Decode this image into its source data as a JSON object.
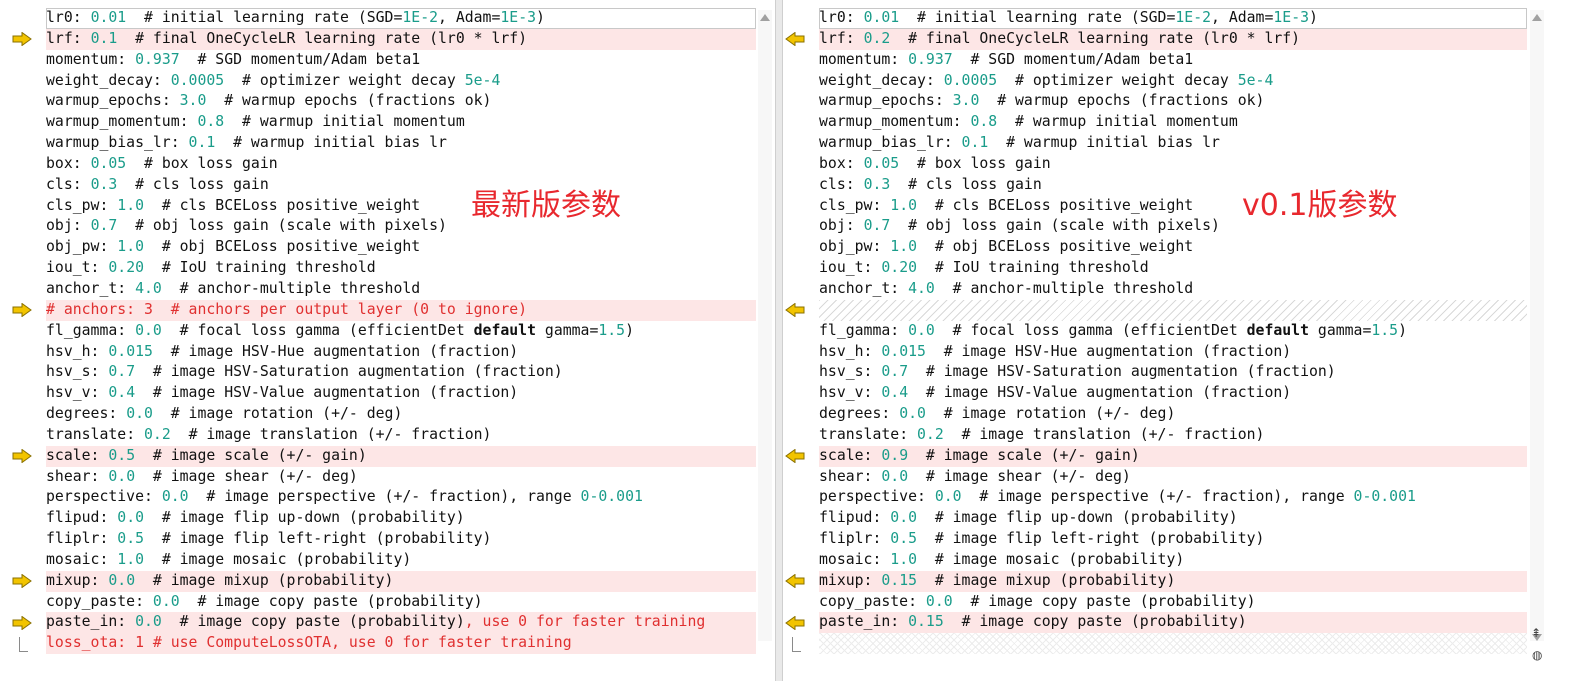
{
  "overlay_labels": {
    "left": "最新版参数",
    "right": "v0.1版参数"
  },
  "left_lines": [
    {
      "key": "lr0",
      "val": "0.01",
      "mid": "  # initial learning rate (SGD=",
      "n1": "1E-2",
      "mid2": ", Adam=",
      "n2": "1E-3",
      "tail": ")"
    },
    {
      "key": "lrf",
      "val": "0.1",
      "mid": "  # final OneCycleLR learning rate (lr0 * lrf)"
    },
    {
      "key": "momentum",
      "val": "0.937",
      "mid": "  # SGD momentum/Adam beta1"
    },
    {
      "key": "weight_decay",
      "val": "0.0005",
      "mid": "  # optimizer weight decay ",
      "n1": "5e-4"
    },
    {
      "key": "warmup_epochs",
      "val": "3.0",
      "mid": "  # warmup epochs (fractions ok)"
    },
    {
      "key": "warmup_momentum",
      "val": "0.8",
      "mid": "  # warmup initial momentum"
    },
    {
      "key": "warmup_bias_lr",
      "val": "0.1",
      "mid": "  # warmup initial bias lr"
    },
    {
      "key": "box",
      "val": "0.05",
      "mid": "  # box loss gain"
    },
    {
      "key": "cls",
      "val": "0.3",
      "mid": "  # cls loss gain"
    },
    {
      "key": "cls_pw",
      "val": "1.0",
      "mid": "  # cls BCELoss positive_weight"
    },
    {
      "key": "obj",
      "val": "0.7",
      "mid": "  # obj loss gain (scale with pixels)"
    },
    {
      "key": "obj_pw",
      "val": "1.0",
      "mid": "  # obj BCELoss positive_weight"
    },
    {
      "key": "iou_t",
      "val": "0.20",
      "mid": "  # IoU training threshold"
    },
    {
      "key": "anchor_t",
      "val": "4.0",
      "mid": "  # anchor-multiple threshold"
    },
    {
      "text": "# anchors: 3  # anchors per output layer (0 to ignore)"
    },
    {
      "key": "fl_gamma",
      "val": "0.0",
      "mid": "  # focal loss gamma (efficientDet ",
      "bold": "default",
      "mid2": " gamma=",
      "n2": "1.5",
      "tail": ")"
    },
    {
      "key": "hsv_h",
      "val": "0.015",
      "mid": "  # image HSV-Hue augmentation (fraction)"
    },
    {
      "key": "hsv_s",
      "val": "0.7",
      "mid": "  # image HSV-Saturation augmentation (fraction)"
    },
    {
      "key": "hsv_v",
      "val": "0.4",
      "mid": "  # image HSV-Value augmentation (fraction)"
    },
    {
      "key": "degrees",
      "val": "0.0",
      "mid": "  # image rotation (+/- deg)"
    },
    {
      "key": "translate",
      "val": "0.2",
      "mid": "  # image translation (+/- fraction)"
    },
    {
      "key": "scale",
      "val": "0.5",
      "mid": "  # image scale (+/- gain)"
    },
    {
      "key": "shear",
      "val": "0.0",
      "mid": "  # image shear (+/- deg)"
    },
    {
      "key": "perspective",
      "val": "0.0",
      "mid": "  # image perspective (+/- fraction), range ",
      "n1": "0-0.001"
    },
    {
      "key": "flipud",
      "val": "0.0",
      "mid": "  # image flip up-down (probability)"
    },
    {
      "key": "fliplr",
      "val": "0.5",
      "mid": "  # image flip left-right (probability)"
    },
    {
      "key": "mosaic",
      "val": "1.0",
      "mid": "  # image mosaic (probability)"
    },
    {
      "key": "mixup",
      "val": "0.0",
      "mid": "  # image mixup (probability)"
    },
    {
      "key": "copy_paste",
      "val": "0.0",
      "mid": "  # image copy paste (probability)"
    },
    {
      "key": "paste_in",
      "val": "0.0",
      "mid": "  # image copy paste (probability)",
      "redtail": ", use 0 for faster training"
    },
    {
      "text": "loss_ota: 1 # use ComputeLossOTA, use 0 for faster training"
    }
  ],
  "right_lines": [
    {
      "key": "lr0",
      "val": "0.01",
      "mid": "  # initial learning rate (SGD=",
      "n1": "1E-2",
      "mid2": ", Adam=",
      "n2": "1E-3",
      "tail": ")"
    },
    {
      "key": "lrf",
      "val": "0.2",
      "mid": "  # final OneCycleLR learning rate (lr0 * lrf)"
    },
    {
      "key": "momentum",
      "val": "0.937",
      "mid": "  # SGD momentum/Adam beta1"
    },
    {
      "key": "weight_decay",
      "val": "0.0005",
      "mid": "  # optimizer weight decay ",
      "n1": "5e-4"
    },
    {
      "key": "warmup_epochs",
      "val": "3.0",
      "mid": "  # warmup epochs (fractions ok)"
    },
    {
      "key": "warmup_momentum",
      "val": "0.8",
      "mid": "  # warmup initial momentum"
    },
    {
      "key": "warmup_bias_lr",
      "val": "0.1",
      "mid": "  # warmup initial bias lr"
    },
    {
      "key": "box",
      "val": "0.05",
      "mid": "  # box loss gain"
    },
    {
      "key": "cls",
      "val": "0.3",
      "mid": "  # cls loss gain"
    },
    {
      "key": "cls_pw",
      "val": "1.0",
      "mid": "  # cls BCELoss positive_weight"
    },
    {
      "key": "obj",
      "val": "0.7",
      "mid": "  # obj loss gain (scale with pixels)"
    },
    {
      "key": "obj_pw",
      "val": "1.0",
      "mid": "  # obj BCELoss positive_weight"
    },
    {
      "key": "iou_t",
      "val": "0.20",
      "mid": "  # IoU training threshold"
    },
    {
      "key": "anchor_t",
      "val": "4.0",
      "mid": "  # anchor-multiple threshold"
    },
    {
      "placeholder": true
    },
    {
      "key": "fl_gamma",
      "val": "0.0",
      "mid": "  # focal loss gamma (efficientDet ",
      "bold": "default",
      "mid2": " gamma=",
      "n2": "1.5",
      "tail": ")"
    },
    {
      "key": "hsv_h",
      "val": "0.015",
      "mid": "  # image HSV-Hue augmentation (fraction)"
    },
    {
      "key": "hsv_s",
      "val": "0.7",
      "mid": "  # image HSV-Saturation augmentation (fraction)"
    },
    {
      "key": "hsv_v",
      "val": "0.4",
      "mid": "  # image HSV-Value augmentation (fraction)"
    },
    {
      "key": "degrees",
      "val": "0.0",
      "mid": "  # image rotation (+/- deg)"
    },
    {
      "key": "translate",
      "val": "0.2",
      "mid": "  # image translation (+/- fraction)"
    },
    {
      "key": "scale",
      "val": "0.9",
      "mid": "  # image scale (+/- gain)"
    },
    {
      "key": "shear",
      "val": "0.0",
      "mid": "  # image shear (+/- deg)"
    },
    {
      "key": "perspective",
      "val": "0.0",
      "mid": "  # image perspective (+/- fraction), range ",
      "n1": "0-0.001"
    },
    {
      "key": "flipud",
      "val": "0.0",
      "mid": "  # image flip up-down (probability)"
    },
    {
      "key": "fliplr",
      "val": "0.5",
      "mid": "  # image flip left-right (probability)"
    },
    {
      "key": "mosaic",
      "val": "1.0",
      "mid": "  # image mosaic (probability)"
    },
    {
      "key": "mixup",
      "val": "0.15",
      "mid": "  # image mixup (probability)"
    },
    {
      "key": "copy_paste",
      "val": "0.0",
      "mid": "  # image copy paste (probability)"
    },
    {
      "key": "paste_in",
      "val": "0.15",
      "mid": "  # image copy paste (probability)"
    },
    {
      "hatch": true
    }
  ],
  "changed_rows": [
    1,
    14,
    21,
    27,
    29,
    30
  ],
  "colors": {
    "number": "#1a9c8a",
    "changed_bg": "#fde6e6",
    "removed_text": "#e03030",
    "arrow_fill": "#f2c400",
    "overlay": "#e8282e"
  },
  "icons": {
    "left_change": "arrow-right-icon",
    "right_change": "arrow-left-icon",
    "scroll_up": "scroll-up-icon",
    "scroll_down": "scroll-down-icon"
  }
}
